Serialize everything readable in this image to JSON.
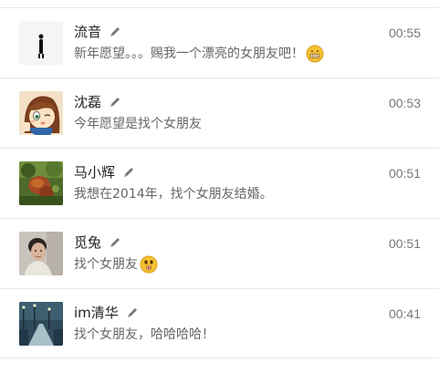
{
  "feed": {
    "items": [
      {
        "name": "流音",
        "message": "新年愿望。。。赐我一个漂亮的女朋友吧！",
        "time": "00:55",
        "avatar": "silhouette-avatar",
        "emoji": "grin-emoji"
      },
      {
        "name": "沈磊",
        "message": "今年愿望是找个女朋友",
        "time": "00:53",
        "avatar": "anime-girl-avatar",
        "emoji": ""
      },
      {
        "name": "马小辉",
        "message": "我想在2014年，找个女朋友结婚。",
        "time": "00:51",
        "avatar": "landscape-avatar",
        "emoji": ""
      },
      {
        "name": "觅兔",
        "message": "找个女朋友",
        "time": "00:51",
        "avatar": "person-photo-avatar",
        "emoji": "surprised-emoji"
      },
      {
        "name": "im清华",
        "message": "找个女朋友，哈哈哈哈！",
        "time": "00:41",
        "avatar": "street-night-avatar",
        "emoji": ""
      }
    ]
  },
  "colors": {
    "border": "#e6e6e6",
    "name": "#222222",
    "message": "#666666",
    "time": "#777777"
  }
}
